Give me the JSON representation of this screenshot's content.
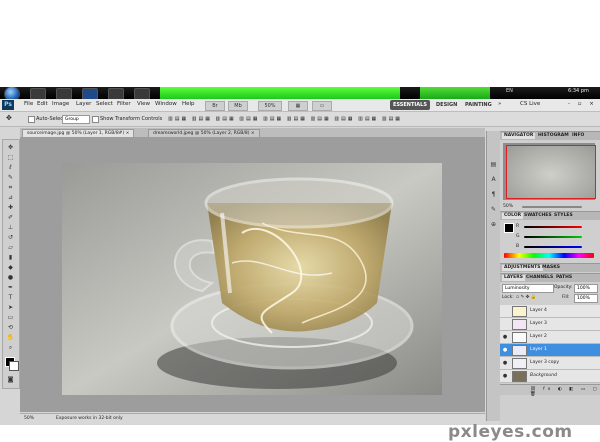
{
  "taskbar": {
    "language": "EN",
    "clock": "6:34 pm",
    "icons": [
      "start-orb",
      "folder-icon",
      "browser-icon",
      "photoshop-icon",
      "media-icon",
      "mail-icon",
      "network-icon"
    ]
  },
  "menubar": {
    "app_logo": "Ps",
    "items": [
      "File",
      "Edit",
      "Image",
      "Layer",
      "Select",
      "Filter",
      "View",
      "Window",
      "Help"
    ],
    "zoom_value": "50%",
    "workspaces": [
      "ESSENTIALS",
      "DESIGN",
      "PAINTING"
    ],
    "cs_live": "CS Live"
  },
  "options_bar": {
    "auto_select_label": "Auto-Select:",
    "auto_select_value": "Group",
    "transform_label": "Show Transform Controls"
  },
  "tabs": [
    {
      "label": "sourceimage.jpg @ 50% (Layer 1, RGB/8#) ×",
      "active": true
    },
    {
      "label": "dreamsworld.jpeg @ 50% (Layer 2, RGB/8) ×",
      "active": false
    }
  ],
  "status": {
    "zoom": "50%",
    "info": "Exposure works in 32-bit only"
  },
  "navigator": {
    "tabs": [
      "NAVIGATOR",
      "HISTOGRAM",
      "INFO"
    ],
    "zoom": "50%"
  },
  "color_panel": {
    "tabs": [
      "COLOR",
      "SWATCHES",
      "STYLES"
    ],
    "channels": [
      "R",
      "G",
      "B"
    ]
  },
  "adjustments": {
    "tabs": [
      "ADJUSTMENTS",
      "MASKS"
    ]
  },
  "layers_panel": {
    "tabs": [
      "LAYERS",
      "CHANNELS",
      "PATHS"
    ],
    "blend_mode": "Luminosity",
    "opacity_label": "Opacity:",
    "opacity_value": "100%",
    "lock_label": "Lock:",
    "fill_label": "Fill:",
    "fill_value": "100%",
    "layers": [
      {
        "name": "Layer 4",
        "visible": false,
        "selected": false
      },
      {
        "name": "Layer 3",
        "visible": false,
        "selected": false
      },
      {
        "name": "Layer 2",
        "visible": true,
        "selected": false
      },
      {
        "name": "Layer 1",
        "visible": true,
        "selected": true
      },
      {
        "name": "Layer 3 copy",
        "visible": true,
        "selected": false
      },
      {
        "name": "Background",
        "visible": true,
        "selected": false
      }
    ]
  },
  "colors": {
    "foreground": "#000000",
    "background": "#ffffff",
    "selection": "#3f8fe0",
    "taskbar_accent": "#3cff2a"
  },
  "watermark": "pxleyes.com"
}
